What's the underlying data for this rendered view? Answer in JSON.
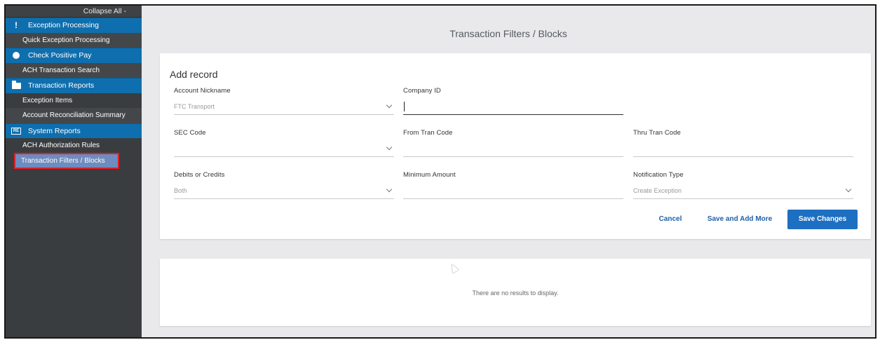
{
  "sidebar": {
    "collapse_all": "Collapse All -",
    "items": [
      {
        "label": "Exception Processing",
        "type": "section",
        "icon": "exclamation-icon"
      },
      {
        "label": "Quick Exception Processing",
        "type": "sub"
      },
      {
        "label": "Check Positive Pay",
        "type": "section",
        "icon": "circle-icon"
      },
      {
        "label": "ACH Transaction Search",
        "type": "sub"
      },
      {
        "label": "Transaction Reports",
        "type": "section",
        "icon": "folder-icon"
      },
      {
        "label": "Exception Items",
        "type": "sub"
      },
      {
        "label": "Account Reconciliation Summary",
        "type": "sub"
      },
      {
        "label": "System Reports",
        "type": "section",
        "icon": "report-icon",
        "icon_text": "RE"
      },
      {
        "label": "ACH Authorization Rules",
        "type": "sub"
      },
      {
        "label": "Transaction Filters / Blocks",
        "type": "sub",
        "active": true
      }
    ],
    "colors": {
      "section": "#0f6fae",
      "background": "#3a3d40",
      "active": "#6e8cbf",
      "highlight_border": "#e01f26"
    }
  },
  "page": {
    "title": "Transaction Filters / Blocks"
  },
  "form": {
    "title": "Add record",
    "fields": {
      "account_nickname": {
        "label": "Account Nickname",
        "value": "FTC Transport"
      },
      "company_id": {
        "label": "Company ID",
        "value": ""
      },
      "sec_code": {
        "label": "SEC Code",
        "value": ""
      },
      "from_tran_code": {
        "label": "From Tran Code",
        "value": ""
      },
      "thru_tran_code": {
        "label": "Thru Tran Code",
        "value": ""
      },
      "debits_or_credits": {
        "label": "Debits or Credits",
        "value": "Both"
      },
      "minimum_amount": {
        "label": "Minimum Amount",
        "value": ""
      },
      "notification_type": {
        "label": "Notification Type",
        "value": "Create Exception"
      }
    },
    "buttons": {
      "cancel": "Cancel",
      "save_add_more": "Save and Add More",
      "save_changes": "Save Changes"
    }
  },
  "results": {
    "empty_message": "There are no results to display."
  }
}
